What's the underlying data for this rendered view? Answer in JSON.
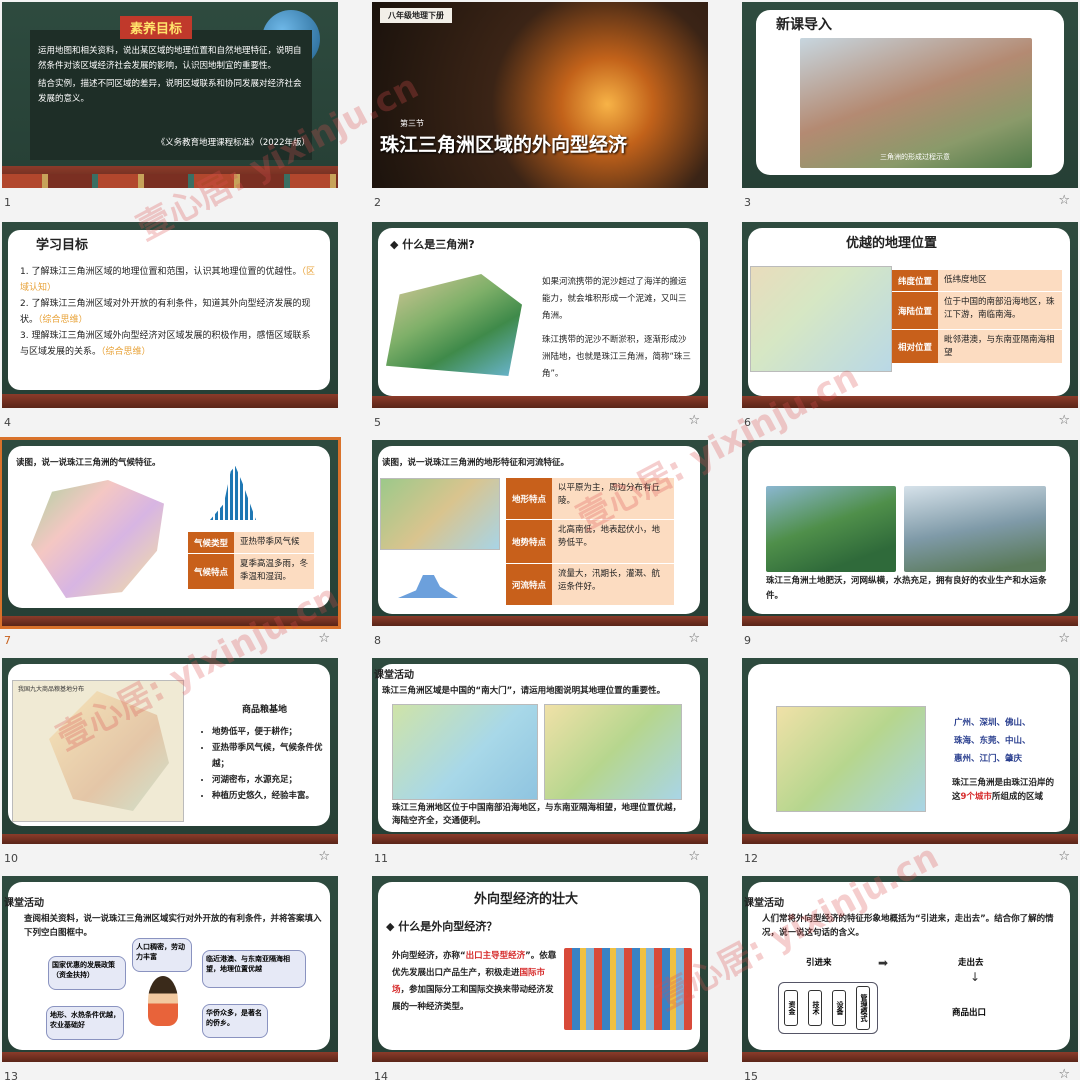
{
  "slides": [
    {
      "num": "1",
      "tag": "素养目标",
      "bullets": [
        "运用地图和相关资料，说出某区域的地理位置和自然地理特征，说明自然条件对该区域经济社会发展的影响，认识因地制宜的重要性。",
        "结合实例，描述不同区域的差异，说明区域联系和协同发展对经济社会发展的意义。"
      ],
      "source": "《义务教育地理课程标准》（2022年版）"
    },
    {
      "num": "2",
      "badge": "八年级地理下册",
      "section": "第三节",
      "title": "珠江三角洲区域的外向型经济"
    },
    {
      "num": "3",
      "title": "新课导入",
      "caption": "三角洲的形成过程示意"
    },
    {
      "num": "4",
      "title": "学习目标",
      "items": [
        {
          "text": "1. 了解珠江三角洲区域的地理位置和范围，认识其地理位置的优越性。",
          "tag": "（区域认知）"
        },
        {
          "text": "2. 了解珠江三角洲区域对外开放的有利条件，知道其外向型经济发展的现状。",
          "tag": "（综合思维）"
        },
        {
          "text": "3. 理解珠江三角洲区域外向型经济对区域发展的积极作用，感悟区域联系与区域发展的关系。",
          "tag": "（综合思维）"
        }
      ]
    },
    {
      "num": "5",
      "title": "什么是三角洲?",
      "p1": "如果河流携带的泥沙超过了海洋的搬运能力，就会堆积形成一个泥滩，又叫三角洲。",
      "p2": "珠江携带的泥沙不断淤积，逐渐形成沙洲陆地，也就是珠江三角洲，简称“珠三角”。"
    },
    {
      "num": "6",
      "title": "优越的地理位置",
      "rows": [
        {
          "k": "纬度位置",
          "v": "低纬度地区"
        },
        {
          "k": "海陆位置",
          "v": "位于中国的南部沿海地区，珠江下游，南临南海。"
        },
        {
          "k": "相对位置",
          "v": "毗邻港澳，与东南亚隔南海相望"
        }
      ]
    },
    {
      "num": "7",
      "prompt": "读图，说一说珠江三角洲的气候特征。",
      "rows": [
        {
          "k": "气候类型",
          "v": "亚热带季风气候"
        },
        {
          "k": "气候特点",
          "v": "夏季高温多雨，冬季温和湿润。"
        }
      ]
    },
    {
      "num": "8",
      "prompt": "读图，说一说珠江三角洲的地形特征和河流特征。",
      "rows": [
        {
          "k": "地形特点",
          "v": "以平原为主，周边分布有丘陵。"
        },
        {
          "k": "地势特点",
          "v": "北高南低，地表起伏小，地势低平。"
        },
        {
          "k": "河流特点",
          "v": "流量大，汛期长，灌溉、航运条件好。"
        }
      ]
    },
    {
      "num": "9",
      "text": "珠江三角洲土地肥沃，河网纵横，水热充足，拥有良好的农业生产和水运条件。"
    },
    {
      "num": "10",
      "map_title": "我国九大商品粮基地分布",
      "heading": "商品粮基地",
      "bullets": [
        "地势低平，便于耕作；",
        "亚热带季风气候，气候条件优越；",
        "河湖密布，水源充足；",
        "种植历史悠久，经验丰富。"
      ]
    },
    {
      "num": "11",
      "tag": "课堂活动",
      "prompt": "珠江三角洲区域是中国的“南大门”，请运用地图说明其地理位置的重要性。",
      "text": "珠江三角洲地区位于中国南部沿海地区，与东南亚隔海相望，地理位置优越，海陆空齐全，交通便利。"
    },
    {
      "num": "12",
      "cities": [
        "广州、深圳、佛山、",
        "珠海、东莞、中山、",
        "惠州、江门、肇庆"
      ],
      "note_a": "珠江三角洲是由珠江沿岸的这",
      "note_b": "9个城市",
      "note_c": "所组成的区域"
    },
    {
      "num": "13",
      "tag": "课堂活动",
      "prompt": "查阅相关资料，说一说珠江三角洲区域实行对外开放的有利条件，并将答案填入下列空白图框中。",
      "bubbles": [
        "国家优惠的发展政策（资金扶持）",
        "人口稠密，劳动力丰富",
        "临近港澳、与东南亚隔海相望，地理位置优越",
        "地形、水热条件优越，农业基础好",
        "华侨众多，是著名的侨乡。"
      ]
    },
    {
      "num": "14",
      "title": "外向型经济的壮大",
      "q": "什么是外向型经济？",
      "t1": "外向型经济，亦称“",
      "t2": "出口主导型经济",
      "t3": "”。依靠优先发展出口产品生产，积极走进",
      "t4": "国际市场",
      "t5": "，参加国际分工和国际交换来带动经济发展的一种经济类型。"
    },
    {
      "num": "15",
      "tag": "课堂活动",
      "prompt": "人们常将外向型经济的特征形象地概括为“引进来，走出去”。结合你了解的情况，说一说这句话的含义。",
      "left": "引进来",
      "right": "走出去",
      "boxes": [
        "资金",
        "技术",
        "设备",
        "管理模式"
      ],
      "out": "商品出口"
    }
  ],
  "selected_slide": "7",
  "watermark": "壹心居: yixinju.cn",
  "colors": {
    "board": "#2d4a3e",
    "accent": "#c8601b",
    "select": "#d9722b",
    "red": "#c0392b"
  }
}
